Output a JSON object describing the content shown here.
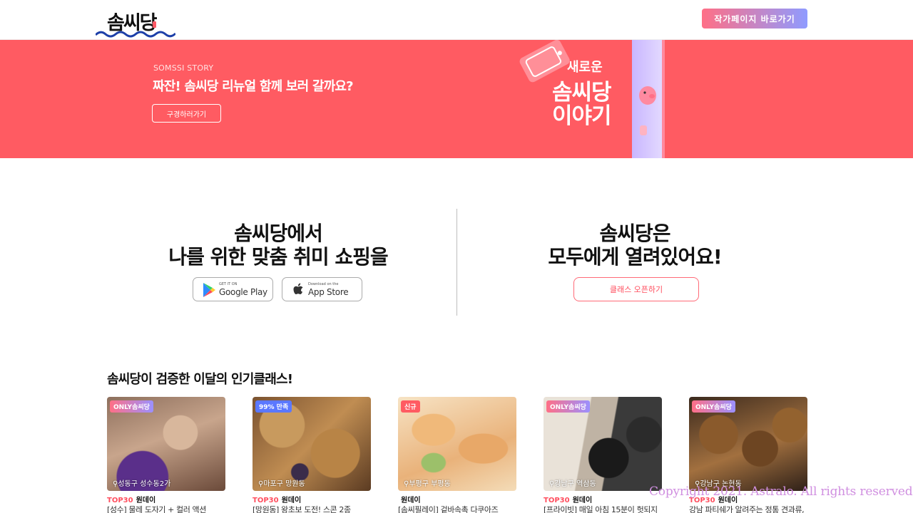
{
  "header": {
    "logo_text": "솜씨당",
    "author_button_label": "작가페이지 바로가기"
  },
  "banner": {
    "kicker": "SOMSSI STORY",
    "title": "짜잔! 솜씨당 리뉴얼 함께 보러 갈까요?",
    "button_label": "구경하러가기",
    "art_sub": "새로운",
    "art_main_line1": "솜씨당",
    "art_main_line2": "이야기",
    "color": "#ff5b62"
  },
  "promo": {
    "left_title_line1": "솜씨당에서",
    "left_title_line2": "나를 위한 맞춤 취미 쇼핑을",
    "google_play": {
      "small": "GET IT ON",
      "big": "Google Play"
    },
    "app_store": {
      "small": "Download on the",
      "big": "App Store"
    },
    "right_title_line1": "솜씨당은",
    "right_title_line2": "모두에게 열려있어요!",
    "open_class_label": "클래스 오픈하기"
  },
  "popular": {
    "title": "솜씨당이 검증한 이달의 인기클래스!",
    "cards": [
      {
        "tag": "ONLY솜씨당",
        "location": "성동구 성수동2가",
        "rank": "TOP30",
        "category": "원데이",
        "title": "[성수] 물레 도자기 + 컬러 액션"
      },
      {
        "tag": "99% 만족",
        "location": "마포구 망원동",
        "rank": "TOP30",
        "category": "원데이",
        "title": "[망원동] 왕초보 도전! 스콘 2종"
      },
      {
        "tag": "신규",
        "location": "부평구 부평동",
        "rank": "",
        "category": "원데이",
        "title": "[솜씨필레이] 겉바속촉 다쿠아즈"
      },
      {
        "tag": "ONLY솜씨당",
        "location": "강남구 역삼동",
        "rank": "TOP30",
        "category": "원데이",
        "title": "[프라이빗] 매일 아침 15분이 헛되지"
      },
      {
        "tag": "ONLY솜씨당",
        "location": "강남구 논현동",
        "rank": "TOP30",
        "category": "원데이",
        "title": "강남 파티쉐가 알려주는 정통 견과류,"
      }
    ]
  },
  "copyright": "Copyright 2021. Astralo. All rights reserved"
}
